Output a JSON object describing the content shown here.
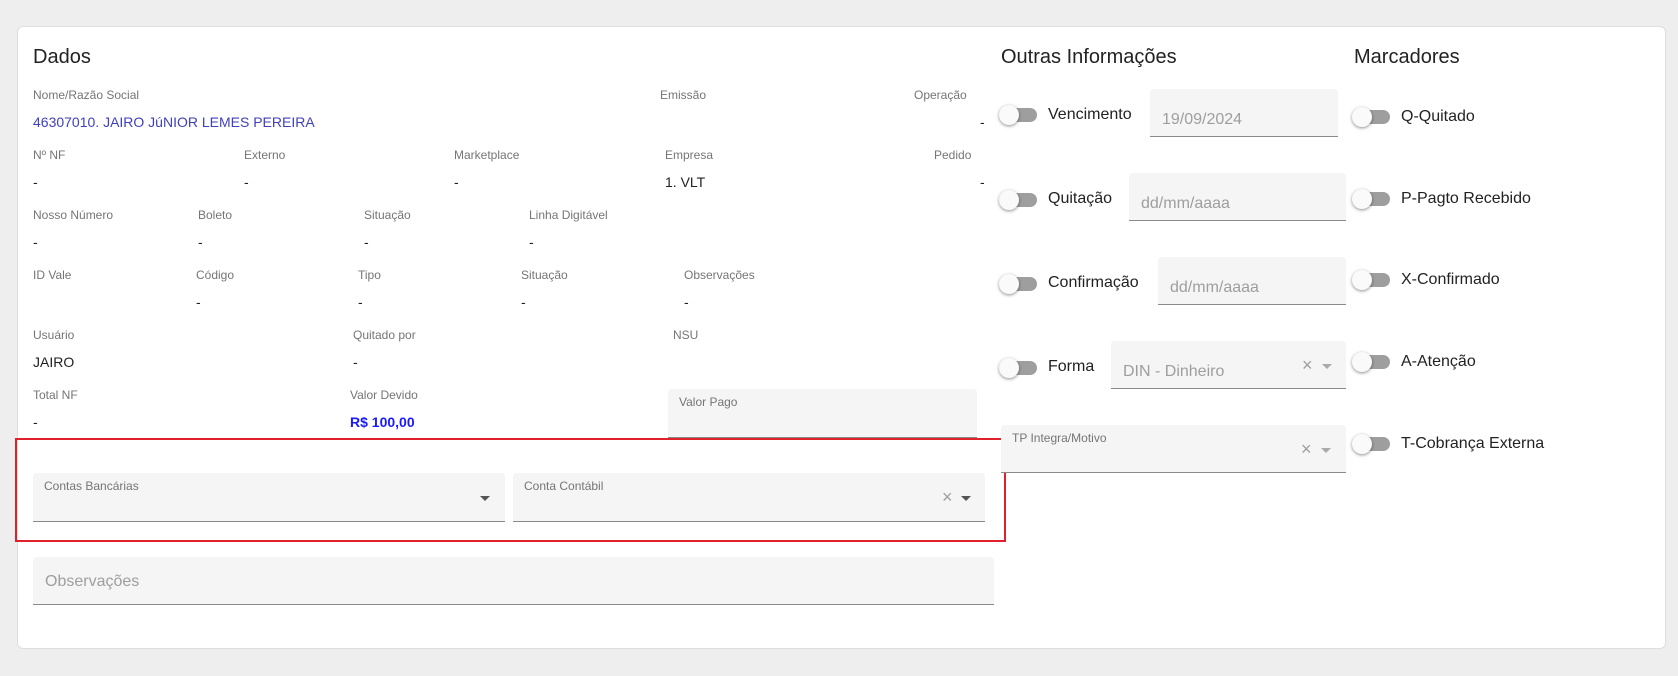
{
  "dados": {
    "title": "Dados",
    "nome_label": "Nome/Razão Social",
    "nome_value": "46307010. JAIRO JúNIOR LEMES PEREIRA",
    "emissao_label": "Emissão",
    "operacao_label": "Operação",
    "operacao_value": "-",
    "nf_label": "Nº NF",
    "nf_value": "-",
    "externo_label": "Externo",
    "externo_value": "-",
    "marketplace_label": "Marketplace",
    "marketplace_value": "-",
    "empresa_label": "Empresa",
    "empresa_value": "1. VLT",
    "pedido_label": "Pedido",
    "pedido_value": "-",
    "nosso_numero_label": "Nosso Número",
    "nosso_numero_value": "-",
    "boleto_label": "Boleto",
    "boleto_value": "-",
    "situacao1_label": "Situação",
    "situacao1_value": "-",
    "linha_label": "Linha Digitável",
    "linha_value": "-",
    "id_vale_label": "ID Vale",
    "codigo_label": "Código",
    "codigo_value": "-",
    "tipo_label": "Tipo",
    "tipo_value": "-",
    "situacao2_label": "Situação",
    "situacao2_value": "-",
    "obs_label": "Observações",
    "obs_value": "-",
    "usuario_label": "Usuário",
    "usuario_value": "JAIRO",
    "quitado_label": "Quitado por",
    "quitado_value": "-",
    "nsu_label": "NSU",
    "total_nf_label": "Total NF",
    "total_nf_value": "-",
    "valor_devido_label": "Valor Devido",
    "valor_devido_value": "R$ 100,00",
    "valor_pago_label": "Valor Pago",
    "contas_bancarias_label": "Contas Bancárias",
    "conta_contabil_label": "Conta Contábil",
    "observacoes_placeholder": "Observações"
  },
  "outras": {
    "title": "Outras Informações",
    "vencimento_label": "Vencimento",
    "vencimento_value": "19/09/2024",
    "quitacao_label": "Quitação",
    "quitacao_placeholder": "dd/mm/aaaa",
    "confirmacao_label": "Confirmação",
    "confirmacao_placeholder": "dd/mm/aaaa",
    "forma_label": "Forma",
    "forma_value": "DIN - Dinheiro",
    "tp_label": "TP Integra/Motivo"
  },
  "marcadores": {
    "title": "Marcadores",
    "items": [
      "Q-Quitado",
      "P-Pagto Recebido",
      "X-Confirmado",
      "A-Atenção",
      "T-Cobrança Externa"
    ]
  },
  "icons": {
    "clear": "×",
    "dropdown": "caret-down-icon"
  },
  "colors": {
    "link": "#3f3fbf",
    "money": "#1a1aff",
    "highlight": "#e0202a"
  }
}
